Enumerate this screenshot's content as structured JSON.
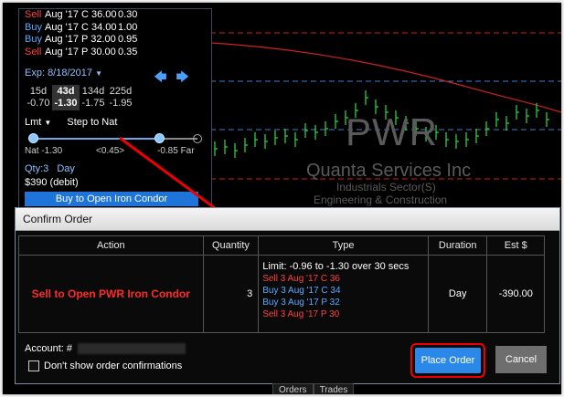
{
  "trade_panel": {
    "legs": [
      {
        "action": "Sell",
        "desc": "Aug '17 C 36.00",
        "price": "0.30"
      },
      {
        "action": "Buy",
        "desc": "Aug '17 C 34.00",
        "price": "1.00"
      },
      {
        "action": "Buy",
        "desc": "Aug '17 P 32.00",
        "price": "0.95"
      },
      {
        "action": "Sell",
        "desc": "Aug '17 P 30.00",
        "price": "0.35"
      }
    ],
    "expiration": "Exp: 8/18/2017",
    "expiration_chevron": "chevron-down-icon",
    "nav_icons": [
      "arrow-left-icon",
      "arrow-right-icon"
    ],
    "dte": [
      {
        "days": "15d",
        "price": "-0.70"
      },
      {
        "days": "43d",
        "price": "-1.30"
      },
      {
        "days": "134d",
        "price": "-1.75"
      },
      {
        "days": "225d",
        "price": "-1.95"
      }
    ],
    "limit_type": "Lmt",
    "step": "Step to Nat",
    "slider_left_label": "Nat -1.30",
    "slider_mid_label": "<0.45>",
    "slider_right_label": "-0.85 Far",
    "qty": "Qty:3",
    "duration": "Day",
    "price": "$390 (debit)",
    "buy_button": "Buy to Open Iron Condor"
  },
  "chart_bg": {
    "symbol": "PWR",
    "company": "Quanta Services Inc",
    "sector": "Industrials Sector(S)",
    "industry": "Engineering & Construction"
  },
  "dialog": {
    "title": "Confirm Order",
    "headers": [
      "Action",
      "Quantity",
      "Type",
      "Duration",
      "Est $"
    ],
    "row": {
      "action": "Sell to Open PWR Iron Condor",
      "quantity": "3",
      "limit": "Limit: -0.96 to -1.30 over 30 secs",
      "type_legs": [
        {
          "side": "sell",
          "text": "Sell 3 Aug '17 C 36"
        },
        {
          "side": "buy",
          "text": "Buy 3 Aug '17 C 34"
        },
        {
          "side": "buy",
          "text": "Buy 3 Aug '17 P 32"
        },
        {
          "side": "sell",
          "text": "Sell 3 Aug '17 P 30"
        }
      ],
      "duration": "Day",
      "est": "-390.00"
    },
    "account_label": "Account: #",
    "checkbox_label": "Don't show order confirmations",
    "place_button": "Place Order",
    "cancel_button": "Cancel"
  },
  "bottom_tabs": [
    "Orders",
    "Trades"
  ],
  "colors": {
    "sell": "#ff4040",
    "buy": "#5aa9ff",
    "accent": "#1e74d8",
    "highlight": "#e00000"
  }
}
